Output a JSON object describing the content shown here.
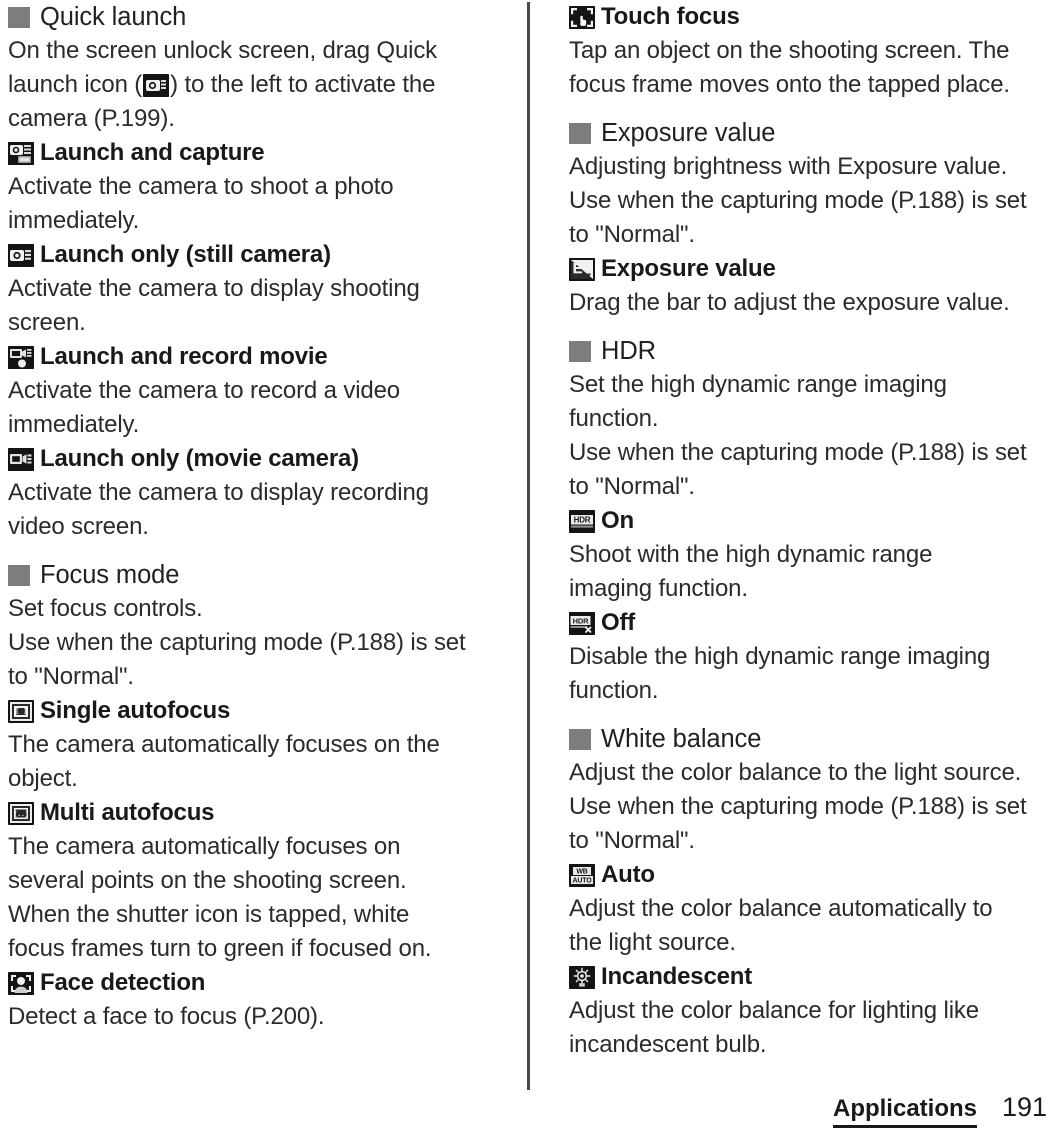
{
  "document": {
    "footer": {
      "chapter": "Applications",
      "page_number": "191"
    }
  },
  "left_column": {
    "sections": [
      {
        "bullet": "gray-square",
        "title": "Quick launch",
        "lines": [
          {
            "type": "text",
            "text": "On the screen unlock screen, drag Quick"
          },
          {
            "type": "text_with_icon",
            "before": "launch icon (",
            "icon": "quick-launch-camera-icon",
            "after": ") to the left to activate the"
          },
          {
            "type": "text",
            "text": "camera (P.199)."
          },
          {
            "type": "item",
            "icon": "launch-and-capture-icon",
            "label": "Launch and capture"
          },
          {
            "type": "text",
            "text": "Activate the camera to shoot a photo"
          },
          {
            "type": "text",
            "text": "immediately."
          },
          {
            "type": "item",
            "icon": "launch-only-still-camera-icon",
            "label": "Launch only (still camera)"
          },
          {
            "type": "text",
            "text": "Activate the camera to display shooting"
          },
          {
            "type": "text",
            "text": "screen."
          },
          {
            "type": "item",
            "icon": "launch-and-record-movie-icon",
            "label": "Launch and record movie"
          },
          {
            "type": "text",
            "text": "Activate the camera to record a video"
          },
          {
            "type": "text",
            "text": "immediately."
          },
          {
            "type": "item",
            "icon": "launch-only-movie-camera-icon",
            "label": "Launch only (movie camera)"
          },
          {
            "type": "text",
            "text": "Activate the camera to display recording"
          },
          {
            "type": "text",
            "text": "video screen."
          }
        ]
      },
      {
        "bullet": "gray-square",
        "title": "Focus mode",
        "lines": [
          {
            "type": "text",
            "text": "Set focus controls."
          },
          {
            "type": "text",
            "text": "Use when the capturing mode (P.188) is set"
          },
          {
            "type": "text",
            "text": "to \"Normal\"."
          },
          {
            "type": "item",
            "icon": "single-autofocus-icon",
            "label": "Single autofocus"
          },
          {
            "type": "text",
            "text": "The camera automatically focuses on the"
          },
          {
            "type": "text",
            "text": "object."
          },
          {
            "type": "item",
            "icon": "multi-autofocus-icon",
            "label": "Multi autofocus"
          },
          {
            "type": "text",
            "text": "The camera automatically focuses on"
          },
          {
            "type": "text",
            "text": "several points on the shooting screen."
          },
          {
            "type": "text",
            "text": "When the shutter icon is tapped, white"
          },
          {
            "type": "text",
            "text": "focus frames turn to green if focused on."
          },
          {
            "type": "item",
            "icon": "face-detection-icon",
            "label": "Face detection"
          },
          {
            "type": "text",
            "text": "Detect a face to focus (P.200)."
          }
        ]
      }
    ]
  },
  "right_column": {
    "sections": [
      {
        "bullet": "none",
        "title": "",
        "lines": [
          {
            "type": "item",
            "icon": "touch-focus-icon",
            "label": "Touch focus"
          },
          {
            "type": "text",
            "text": "Tap an object on the shooting screen. The"
          },
          {
            "type": "text",
            "text": "focus frame moves onto the tapped place."
          }
        ]
      },
      {
        "bullet": "gray-square",
        "title": "Exposure value",
        "lines": [
          {
            "type": "text",
            "text": "Adjusting brightness with Exposure value."
          },
          {
            "type": "text",
            "text": "Use when the capturing mode (P.188) is set"
          },
          {
            "type": "text",
            "text": "to \"Normal\"."
          },
          {
            "type": "item",
            "icon": "exposure-value-icon",
            "label": "Exposure value"
          },
          {
            "type": "text",
            "text": "Drag the bar to adjust the exposure value."
          }
        ]
      },
      {
        "bullet": "gray-square",
        "title": "HDR",
        "lines": [
          {
            "type": "text",
            "text": "Set the high dynamic range imaging"
          },
          {
            "type": "text",
            "text": "function."
          },
          {
            "type": "text",
            "text": "Use when the capturing mode (P.188) is set"
          },
          {
            "type": "text",
            "text": "to \"Normal\"."
          },
          {
            "type": "item",
            "icon": "hdr-on-icon",
            "label": "On"
          },
          {
            "type": "text",
            "text": "Shoot with the high dynamic range"
          },
          {
            "type": "text",
            "text": "imaging function."
          },
          {
            "type": "item",
            "icon": "hdr-off-icon",
            "label": "Off"
          },
          {
            "type": "text",
            "text": "Disable the high dynamic range imaging"
          },
          {
            "type": "text",
            "text": "function."
          }
        ]
      },
      {
        "bullet": "gray-square",
        "title": "White balance",
        "lines": [
          {
            "type": "text",
            "text": "Adjust the color balance to the light source."
          },
          {
            "type": "text",
            "text": "Use when the capturing mode (P.188) is set"
          },
          {
            "type": "text",
            "text": "to \"Normal\"."
          },
          {
            "type": "item",
            "icon": "white-balance-auto-icon",
            "label": "Auto"
          },
          {
            "type": "text",
            "text": "Adjust the color balance automatically to"
          },
          {
            "type": "text",
            "text": "the light source."
          },
          {
            "type": "item",
            "icon": "white-balance-incandescent-icon",
            "label": "Incandescent"
          },
          {
            "type": "text",
            "text": "Adjust the color balance for lighting like"
          },
          {
            "type": "text",
            "text": "incandescent bulb."
          }
        ]
      }
    ]
  },
  "colors": {
    "bullet": "#7d7d7d",
    "divider": "#4a4a4a",
    "body_text": "#2b2b2b",
    "heading_text": "#231f20",
    "icon_background": "#141414"
  }
}
